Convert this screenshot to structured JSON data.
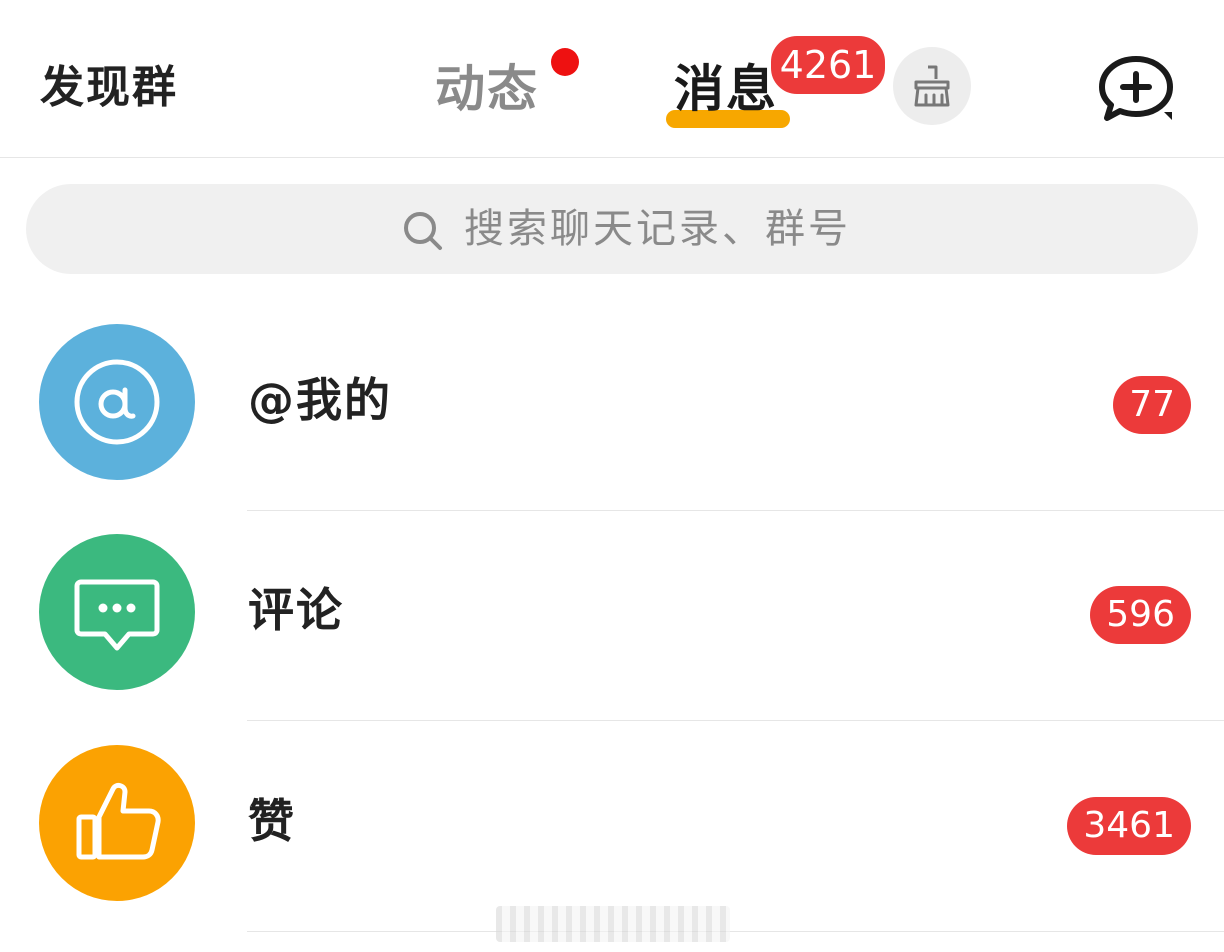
{
  "header": {
    "discover_label": "发现群",
    "tabs": [
      {
        "label": "动态",
        "has_dot": true
      },
      {
        "label": "消息",
        "active": true,
        "badge": "4261"
      }
    ],
    "clean_icon": "broom-icon",
    "new_chat_icon": "chat-plus-icon"
  },
  "search": {
    "placeholder": "搜索聊天记录、群号"
  },
  "list": [
    {
      "label": "@我的",
      "count": "77",
      "icon": "at-icon",
      "color": "#5cb1dc"
    },
    {
      "label": "评论",
      "count": "596",
      "icon": "comment-icon",
      "color": "#3bb97f"
    },
    {
      "label": "赞",
      "count": "3461",
      "icon": "thumbs-up-icon",
      "color": "#fba202"
    }
  ],
  "colors": {
    "accent": "#f7a700",
    "badge": "#ec3a3a",
    "dot": "#ee1111"
  }
}
